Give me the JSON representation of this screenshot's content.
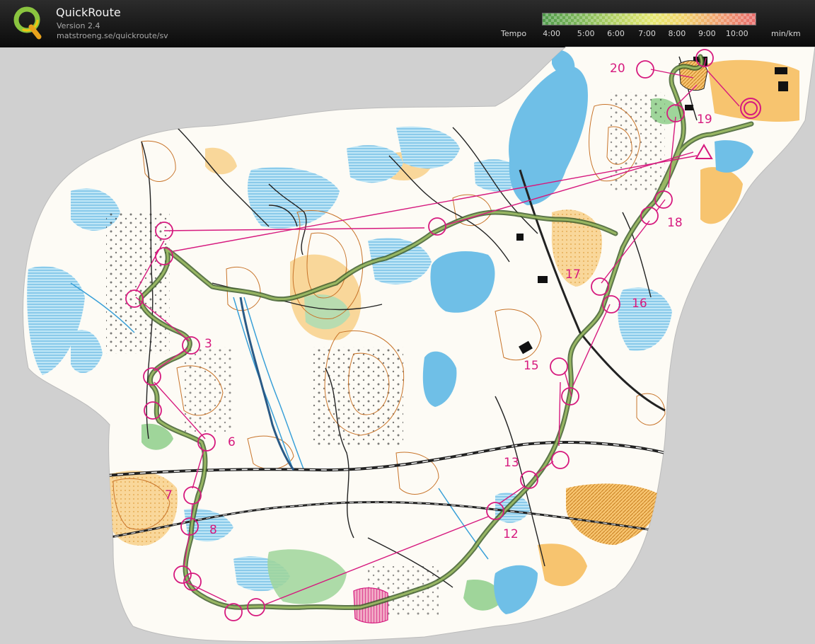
{
  "app": {
    "title": "QuickRoute",
    "version": "Version 2.4",
    "url": "matstroeng.se/quickroute/sv"
  },
  "legend": {
    "title": "Tempo",
    "unit": "min/km",
    "ticks": [
      "4:00",
      "5:00",
      "6:00",
      "7:00",
      "8:00",
      "9:00",
      "10:00"
    ]
  },
  "colors": {
    "course_magenta": "#d6197e",
    "route_green": "#5f7a36",
    "water_blue": "#6fbfe7",
    "open_yellow": "#f7c46f",
    "forest_white": "#fdfbf5",
    "contour_brown": "#c8742a",
    "background_grey": "#d0d0d0",
    "header_dark": "#141414"
  },
  "map": {
    "control_numbers": [
      "3",
      "6",
      "7",
      "8",
      "12",
      "13",
      "15",
      "16",
      "17",
      "18",
      "19",
      "20"
    ],
    "icons": [
      "quickroute-logo-icon",
      "start-triangle-icon",
      "finish-circle-icon"
    ]
  }
}
